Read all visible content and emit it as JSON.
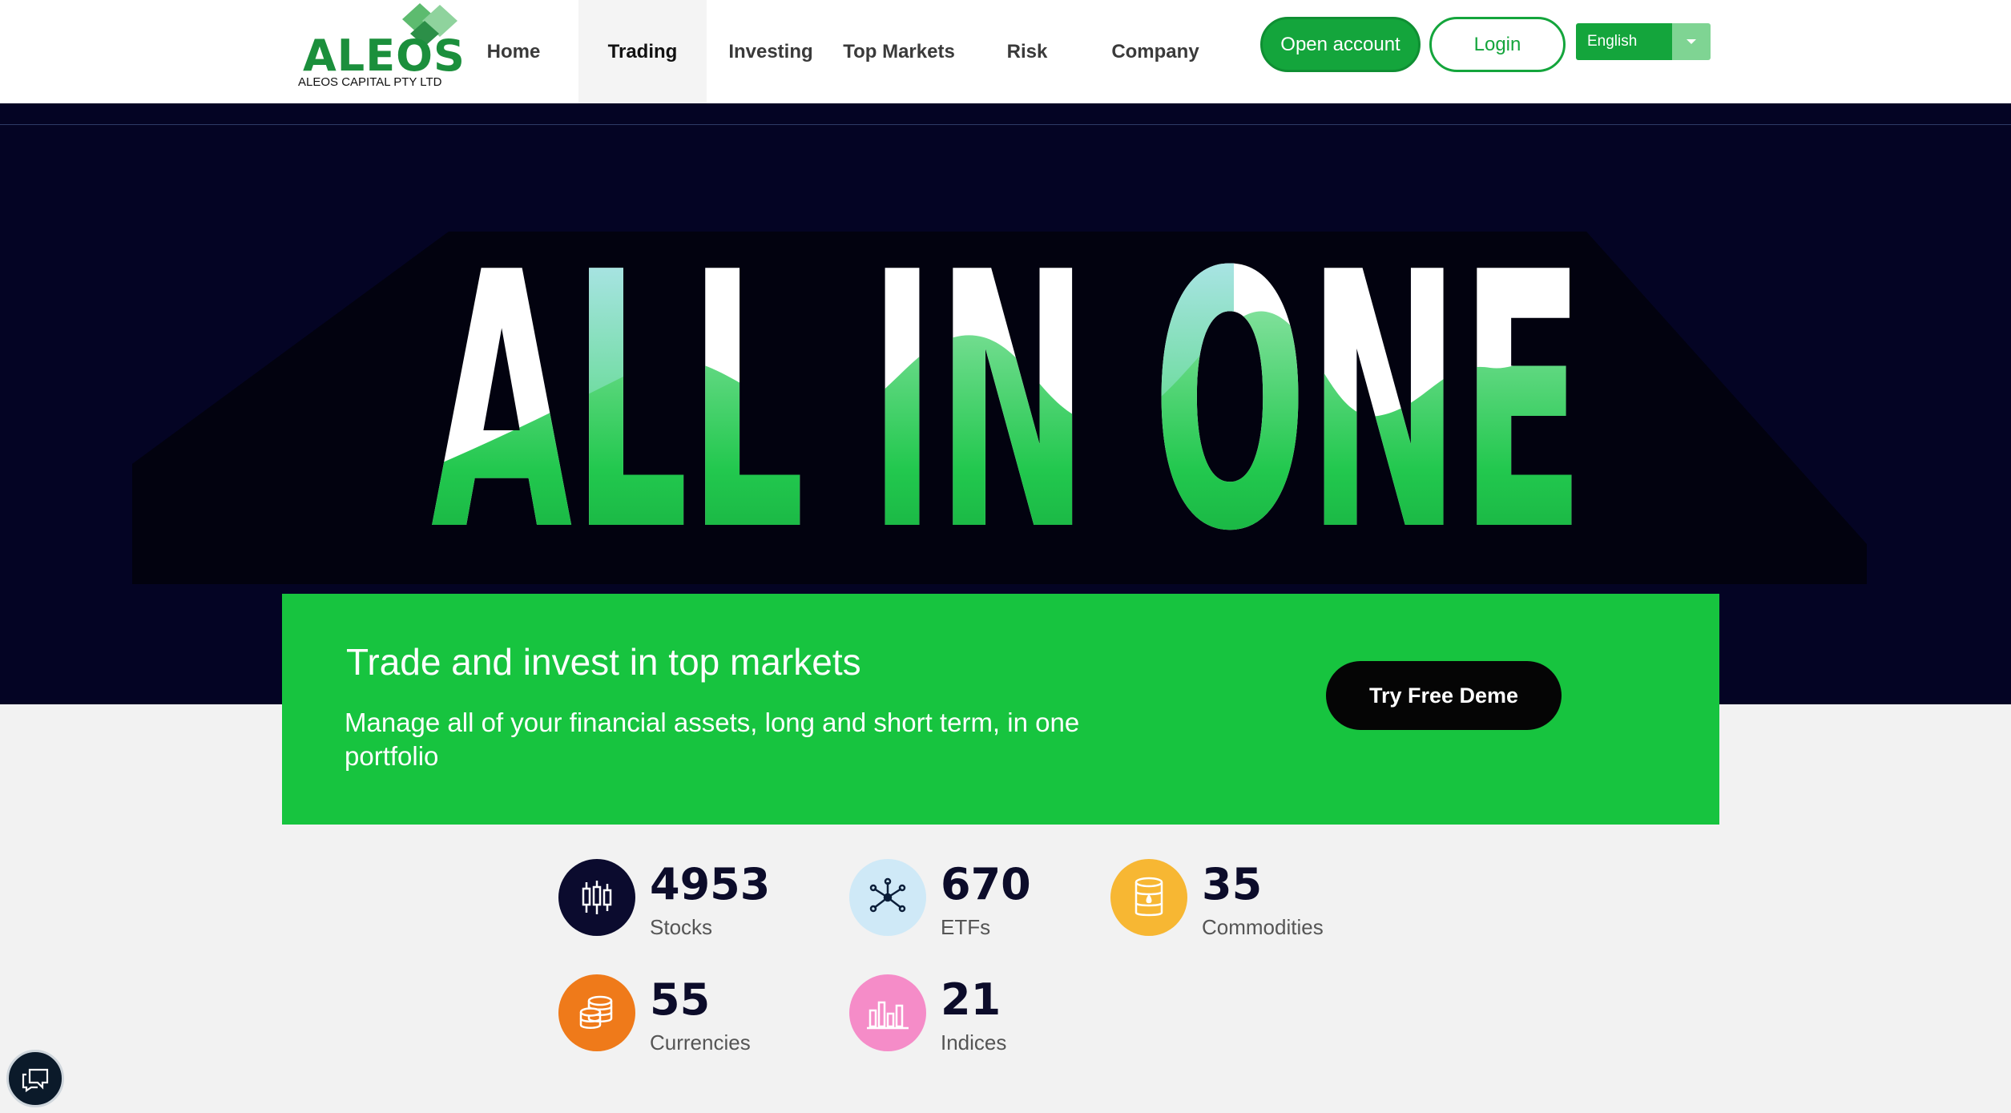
{
  "logo": {
    "text": "ALEOS",
    "subtitle": "ALEOS CAPITAL PTY LTD"
  },
  "nav": {
    "items": [
      {
        "label": "Home",
        "active": false
      },
      {
        "label": "Trading",
        "active": true
      },
      {
        "label": "Investing",
        "active": false
      },
      {
        "label": "Top Markets",
        "active": false
      },
      {
        "label": "Risk",
        "active": false
      },
      {
        "label": "Company",
        "active": false
      }
    ]
  },
  "header": {
    "open_account_label": "Open account",
    "login_label": "Login",
    "language": "English"
  },
  "hero": {
    "headline": "ALL IN ONE"
  },
  "card": {
    "title": "Trade and invest in top markets",
    "description": "Manage all of your financial assets, long and short term, in one portfolio",
    "demo_label": "Try Free Deme"
  },
  "stats": [
    {
      "value": "4953",
      "label": "Stocks",
      "icon": "candlestick-icon",
      "color": "#0b0b2e"
    },
    {
      "value": "670",
      "label": "ETFs",
      "icon": "network-icon",
      "color": "#cfe9f7"
    },
    {
      "value": "35",
      "label": "Commodities",
      "icon": "barrel-icon",
      "color": "#f7b733"
    },
    {
      "value": "55",
      "label": "Currencies",
      "icon": "coins-icon",
      "color": "#ef7a1a"
    },
    {
      "value": "21",
      "label": "Indices",
      "icon": "bar-chart-icon",
      "color": "#f58cc8"
    }
  ],
  "colors": {
    "brand_green": "#14a53c",
    "card_green": "#17c43f",
    "hero_bg": "#040424"
  }
}
